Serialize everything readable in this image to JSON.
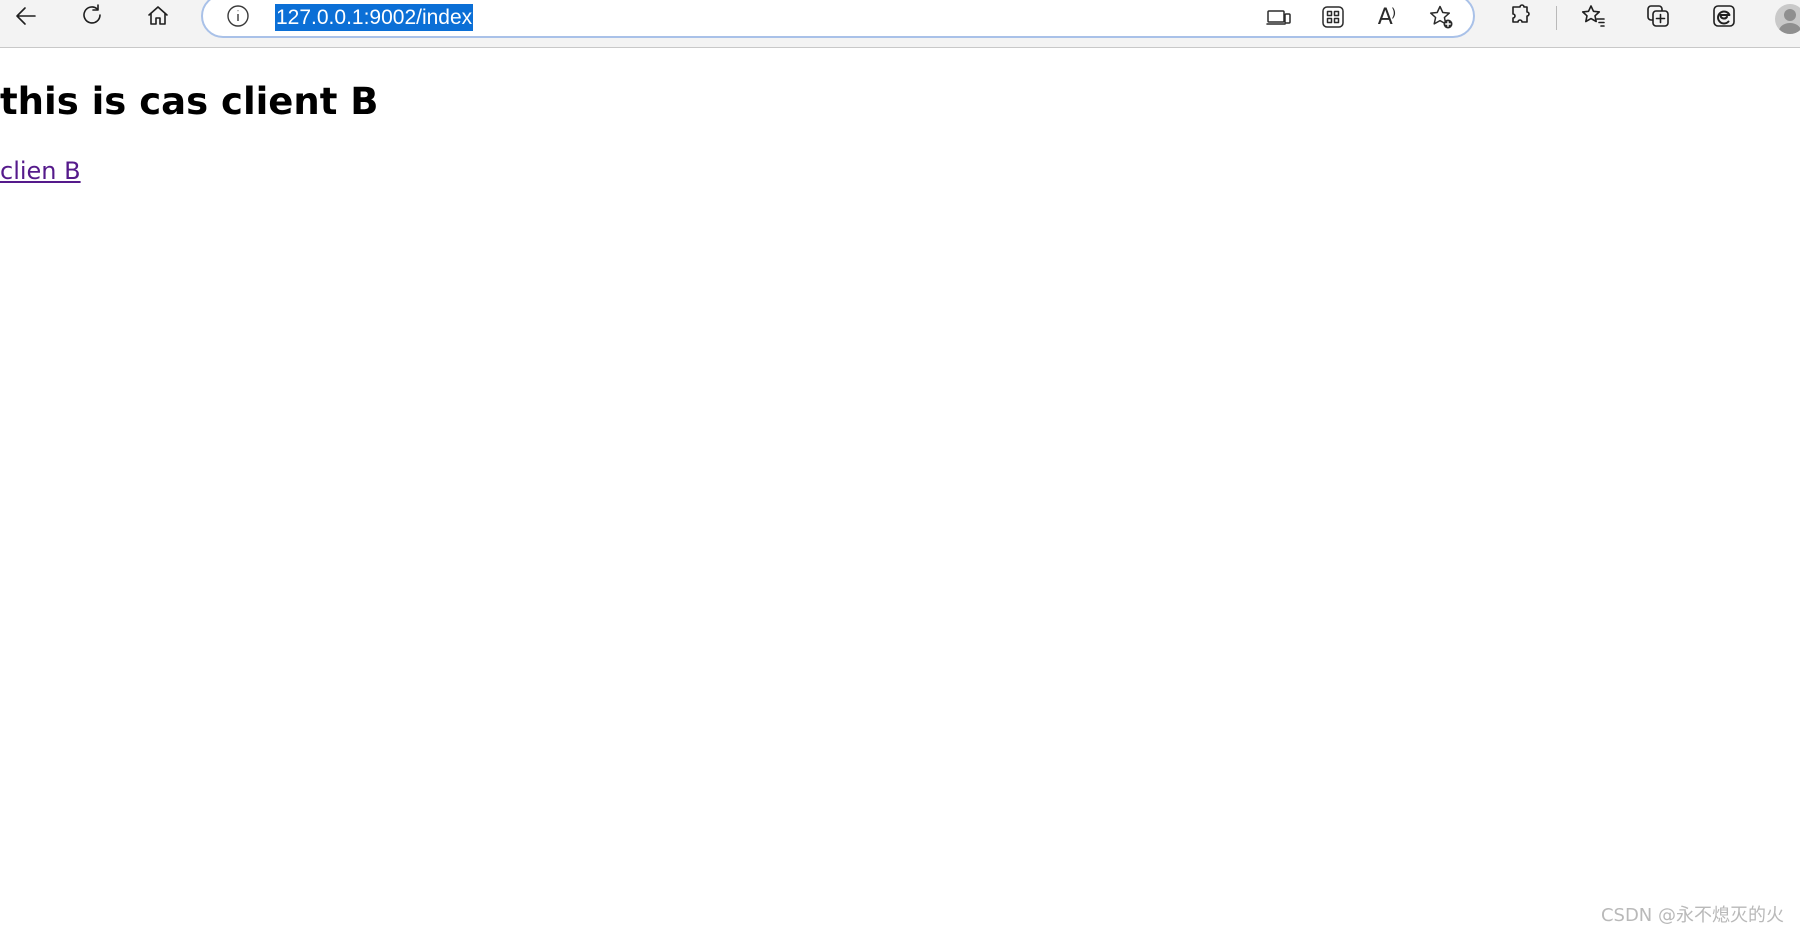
{
  "browser": {
    "address_bar": {
      "url": "127.0.0.1:9002/index",
      "url_selected": true,
      "security_icon": "info-icon"
    },
    "nav_icons": [
      "back-arrow-icon",
      "reload-icon",
      "home-icon"
    ],
    "omnibox_icons": [
      "app-available-icon",
      "apps-grid-icon",
      "read-aloud-icon",
      "add-favorite-icon"
    ],
    "read_aloud_glyph": "A⁾",
    "toolbar_icons": [
      "extensions-icon",
      "favorites-icon",
      "collections-icon",
      "edge-icon",
      "profile-avatar-icon"
    ],
    "colors": {
      "toolbar_bg": "#f3f3f3",
      "url_highlight": "#0b6fd6",
      "omnibox_border": "#a9c1e8",
      "visited_link": "#551a8b"
    }
  },
  "page": {
    "title": "this is cas client B",
    "link_text": "clien B"
  },
  "watermark": {
    "text": "CSDN @永不熄灭的火"
  }
}
